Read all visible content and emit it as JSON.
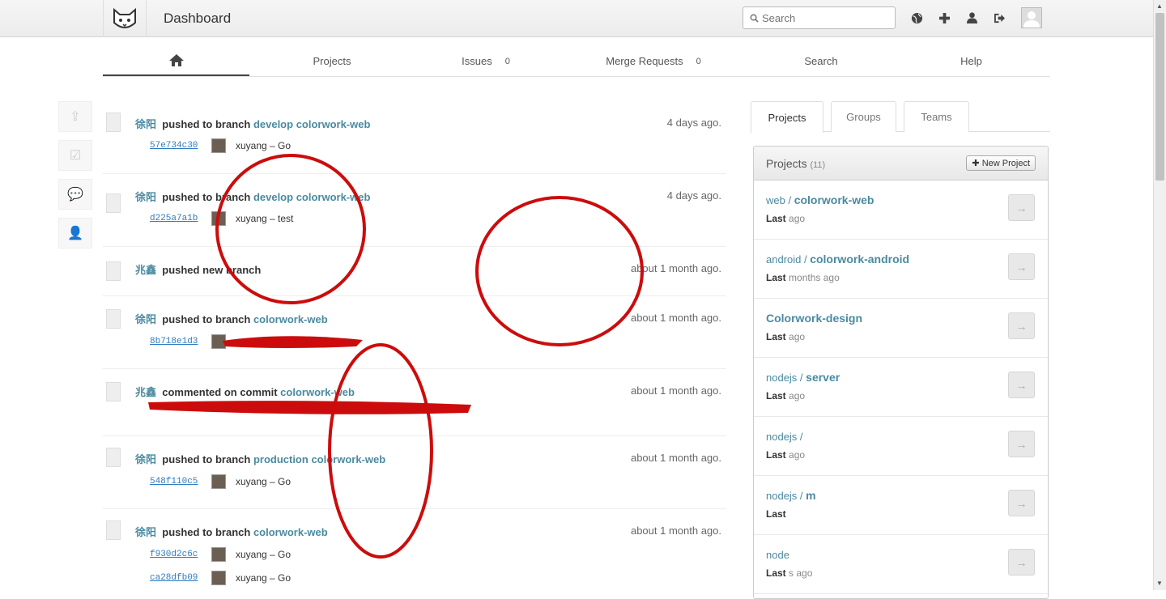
{
  "app": {
    "title": "Dashboard"
  },
  "search": {
    "placeholder": "Search"
  },
  "topbar_icons": [
    "globe-icon",
    "plus-icon",
    "user-icon",
    "logout-icon"
  ],
  "nav": {
    "projects": "Projects",
    "issues": "Issues",
    "issues_count": "0",
    "merge_requests": "Merge Requests",
    "merge_requests_count": "0",
    "search": "Search",
    "help": "Help"
  },
  "events": [
    {
      "author": "徐阳",
      "action": "pushed to branch",
      "ref": "develop",
      "target": "colorwork-web",
      "time": "4 days ago.",
      "commits": [
        {
          "sha": "57e734c30",
          "author": "xuyang",
          "msg": "Go"
        }
      ]
    },
    {
      "author": "徐阳",
      "action": "pushed to branch",
      "ref": "develop",
      "target": "colorwork-web",
      "time": "4 days ago.",
      "commits": [
        {
          "sha": "d225a7a1b",
          "author": "xuyang",
          "msg": "test"
        }
      ]
    },
    {
      "author": "兆鑫",
      "action": "pushed new branch",
      "ref": "",
      "target": "",
      "time": "about 1 month ago.",
      "commits": []
    },
    {
      "author": "徐阳",
      "action": "pushed to branch",
      "ref": "",
      "target": "colorwork-web",
      "time": "about 1 month ago.",
      "commits": [
        {
          "sha": "8b718e1d3",
          "author": "",
          "msg": ""
        }
      ]
    },
    {
      "author": "兆鑫",
      "action": "commented on commit",
      "ref": "",
      "target": "colorwork-web",
      "time": "about 1 month ago.",
      "commits": []
    },
    {
      "author": "徐阳",
      "action": "pushed to branch",
      "ref": "production",
      "target": "colorwork-web",
      "time": "about 1 month ago.",
      "commits": [
        {
          "sha": "548f110c5",
          "author": "xuyang",
          "msg": "Go"
        }
      ]
    },
    {
      "author": "徐阳",
      "action": "pushed to branch",
      "ref": "",
      "target": "colorwork-web",
      "time": "about 1 month ago.",
      "commits": [
        {
          "sha": "f930d2c6c",
          "author": "xuyang",
          "msg": "Go"
        },
        {
          "sha": "ca28dfb09",
          "author": "xuyang",
          "msg": "Go"
        }
      ]
    }
  ],
  "right_tabs": {
    "projects": "Projects",
    "groups": "Groups",
    "teams": "Teams"
  },
  "projects_panel": {
    "title": "Projects",
    "count": "(11)",
    "new_button": "New Project",
    "items": [
      {
        "ns": "web / ",
        "name": "colorwork-web",
        "last": "Last",
        "ago": "ago"
      },
      {
        "ns": "android / ",
        "name": "colorwork-android",
        "last": "Last",
        "ago": "months ago"
      },
      {
        "ns": "",
        "name": "Colorwork-design",
        "last": "Last",
        "ago": "ago"
      },
      {
        "ns": "nodejs / ",
        "name": "server",
        "last": "Last",
        "ago": "ago"
      },
      {
        "ns": "nodejs / ",
        "name": "",
        "last": "Last",
        "ago": "ago"
      },
      {
        "ns": "nodejs / ",
        "name": "m",
        "last": "Last",
        "ago": ""
      },
      {
        "ns": "node",
        "name": "",
        "last": "Last",
        "ago": "s ago"
      }
    ]
  },
  "colors": {
    "link": "#4a8aa0",
    "sha": "#2f7bbf",
    "annotation": "#cc0c0c"
  }
}
